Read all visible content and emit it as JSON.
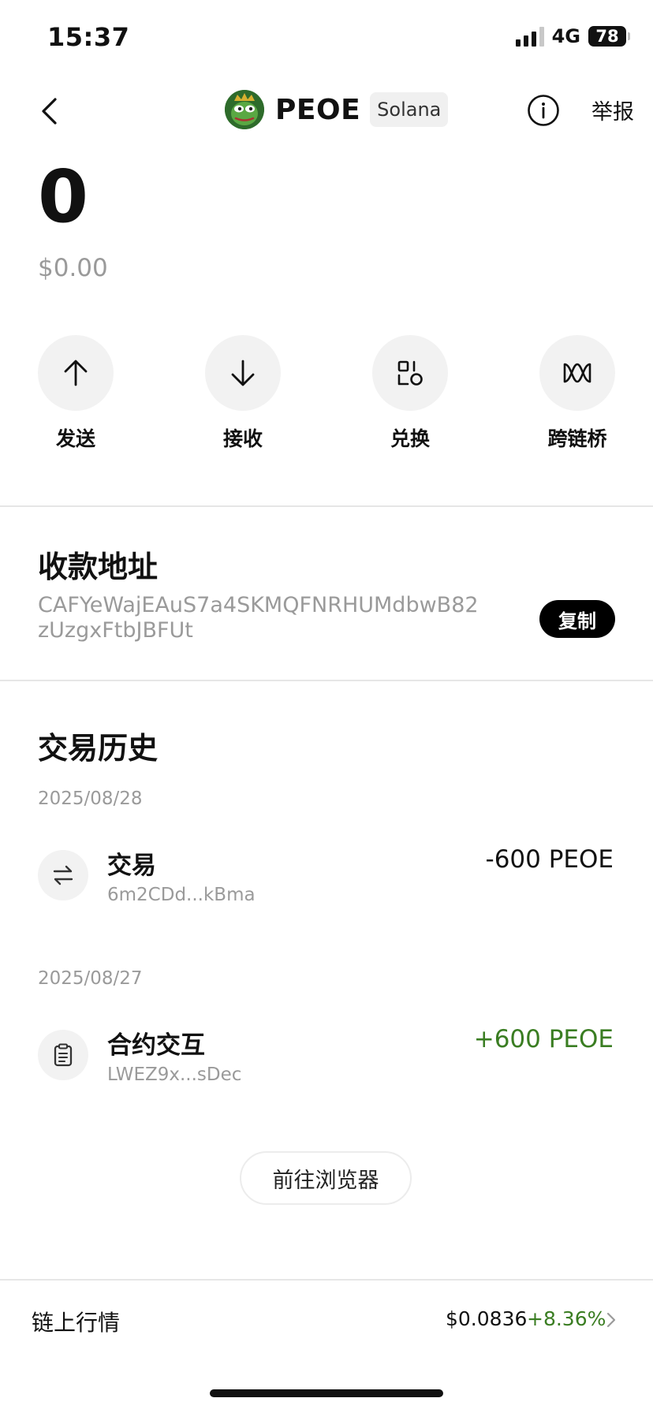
{
  "status_bar": {
    "time": "15:37",
    "network": "4G",
    "battery": "78"
  },
  "header": {
    "token_symbol": "PEOE",
    "chain": "Solana",
    "report_label": "举报",
    "icons": {
      "back": "chevron-left-icon",
      "info": "info-icon",
      "logo": "pepe-token-logo"
    }
  },
  "balance": {
    "amount": "0",
    "usd_value": "$0.00"
  },
  "actions": [
    {
      "label": "发送",
      "icon": "arrow-up-icon"
    },
    {
      "label": "接收",
      "icon": "arrow-down-icon"
    },
    {
      "label": "兑换",
      "icon": "swap-shapes-icon"
    },
    {
      "label": "跨链桥",
      "icon": "bridge-icon"
    }
  ],
  "receive_address": {
    "title": "收款地址",
    "address": "CAFYeWajEAuS7a4SKMQFNRHUMdbwB82zUzgxFtbJBFUt",
    "copy_label": "复制"
  },
  "history": {
    "title": "交易历史",
    "groups": [
      {
        "date": "2025/08/28",
        "items": [
          {
            "title": "交易",
            "hash": "6m2CDd...kBma",
            "amount": "-600 PEOE",
            "icon": "transfer-arrows-icon",
            "direction": "out"
          }
        ]
      },
      {
        "date": "2025/08/27",
        "items": [
          {
            "title": "合约交互",
            "hash": "LWEZ9x...sDec",
            "amount": "+600 PEOE",
            "icon": "clipboard-icon",
            "direction": "in"
          }
        ]
      }
    ],
    "explorer_label": "前往浏览器"
  },
  "market": {
    "label": "链上行情",
    "price": "$0.0836",
    "change": "+8.36%",
    "change_color": "#3a7d22"
  }
}
